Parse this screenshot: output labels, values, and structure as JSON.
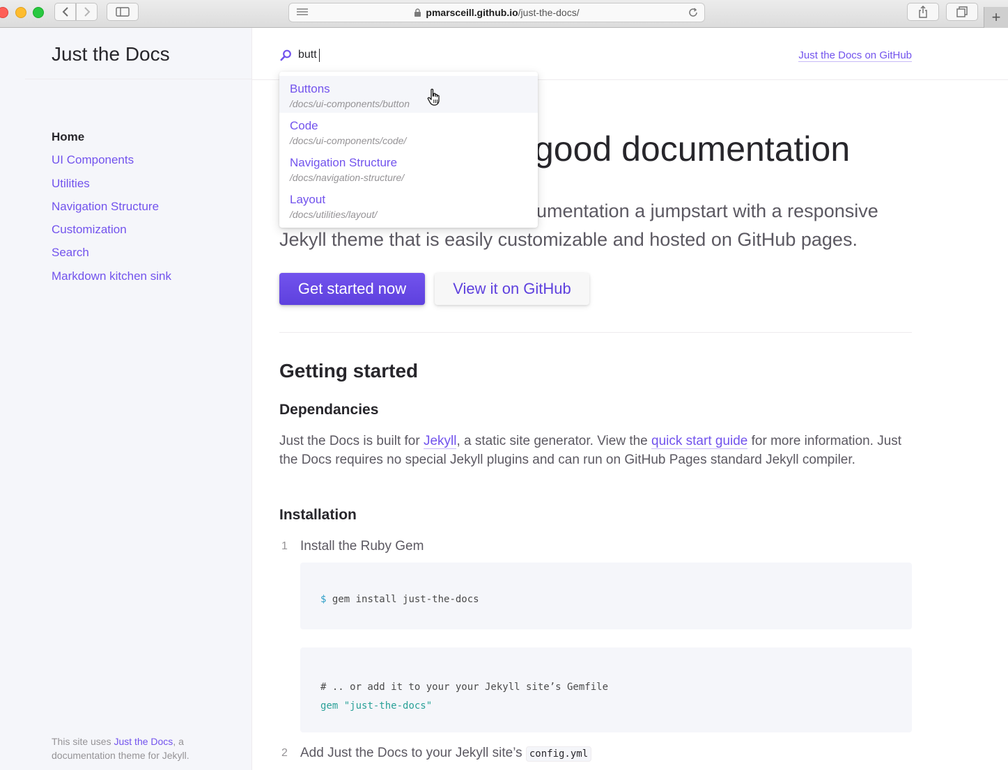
{
  "browser": {
    "url_host": "pmarsceill.github.io",
    "url_path": "/just-the-docs/"
  },
  "sidebar": {
    "site_title": "Just the Docs",
    "nav": [
      {
        "label": "Home",
        "active": true
      },
      {
        "label": "UI Components",
        "active": false
      },
      {
        "label": "Utilities",
        "active": false
      },
      {
        "label": "Navigation Structure",
        "active": false
      },
      {
        "label": "Customization",
        "active": false
      },
      {
        "label": "Search",
        "active": false
      },
      {
        "label": "Markdown kitchen sink",
        "active": false
      }
    ],
    "footer": {
      "prefix": "This site uses ",
      "link": "Just the Docs",
      "suffix": ", a documentation theme for Jekyll."
    }
  },
  "header": {
    "search_value": "butt",
    "aux_link": "Just the Docs on GitHub"
  },
  "search_results": [
    {
      "title": "Buttons",
      "path": "/docs/ui-components/buttons/",
      "visible_path": "/docs/ui-components/button"
    },
    {
      "title": "Code",
      "path": "/docs/ui-components/code/"
    },
    {
      "title": "Navigation Structure",
      "path": "/docs/navigation-structure/"
    },
    {
      "title": "Layout",
      "path": "/docs/utilities/layout/"
    }
  ],
  "main": {
    "hero_title_visible": "good documentation",
    "lead_line1_visible": "umentation a jumpstart with a responsive",
    "lead_line2": "Jekyll theme that is easily customizable and hosted on GitHub pages.",
    "primary_button": "Get started now",
    "secondary_button": "View it on GitHub",
    "getting_started": "Getting started",
    "dependencies_heading": "Dependancies",
    "dependencies_text": {
      "t1": "Just the Docs is built for ",
      "link1": "Jekyll",
      "t2": ", a static site generator. View the ",
      "link2": "quick start guide",
      "t3": " for more information. Just the Docs requires no special Jekyll plugins and can run on GitHub Pages standard Jekyll compiler."
    },
    "installation_heading": "Installation",
    "steps": [
      {
        "number": "1",
        "text": "Install the Ruby Gem"
      },
      {
        "number": "2",
        "text": "Add Just the Docs to your Jekyll site’s ",
        "code": "config.yml"
      }
    ],
    "code1": {
      "prompt": "$",
      "command": "gem install just-the-docs"
    },
    "code2": {
      "comment": "# .. or add it to your your Jekyll site’s Gemfile",
      "keyword": "gem",
      "string": "\"just-the-docs\""
    }
  },
  "colors": {
    "accent": "#7253ed",
    "sidebar_bg": "#f5f6fa",
    "text": "#27262b"
  }
}
